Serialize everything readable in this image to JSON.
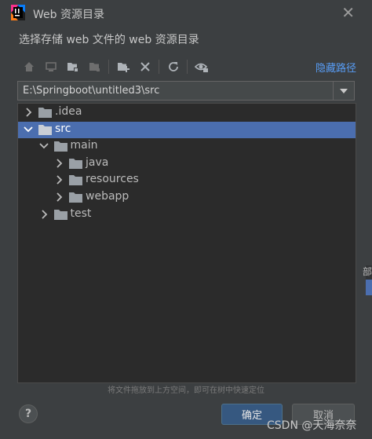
{
  "window": {
    "title": "Web 资源目录",
    "subtitle": "选择存储 web 文件的 web 资源目录"
  },
  "toolbar": {
    "icons": [
      "home-icon",
      "desktop-icon",
      "project-folder-icon",
      "module-folder-icon",
      "new-folder-icon",
      "delete-icon",
      "refresh-icon",
      "show-hidden-icon"
    ],
    "hide_path_label": "隐藏路径"
  },
  "path": {
    "value": "E:\\Springboot\\untitled3\\src"
  },
  "tree": {
    "items": [
      {
        "label": ".idea",
        "depth": 0,
        "expanded": false,
        "selected": false
      },
      {
        "label": "src",
        "depth": 0,
        "expanded": true,
        "selected": true
      },
      {
        "label": "main",
        "depth": 1,
        "expanded": true,
        "selected": false
      },
      {
        "label": "java",
        "depth": 2,
        "expanded": false,
        "selected": false
      },
      {
        "label": "resources",
        "depth": 2,
        "expanded": false,
        "selected": false
      },
      {
        "label": "webapp",
        "depth": 2,
        "expanded": false,
        "selected": false
      },
      {
        "label": "test",
        "depth": 1,
        "expanded": false,
        "selected": false
      }
    ]
  },
  "hint": "将文件拖放到上方空间，即可在树中快速定位",
  "buttons": {
    "help": "?",
    "ok": "确定",
    "cancel": "取消"
  },
  "watermark": "CSDN @天海奈奈",
  "edge_fragment": "部",
  "colors": {
    "background": "#3c3f41",
    "tree_bg": "#2b2b2b",
    "selection": "#4b6eaf",
    "link": "#589df6",
    "ok_button": "#365880"
  }
}
